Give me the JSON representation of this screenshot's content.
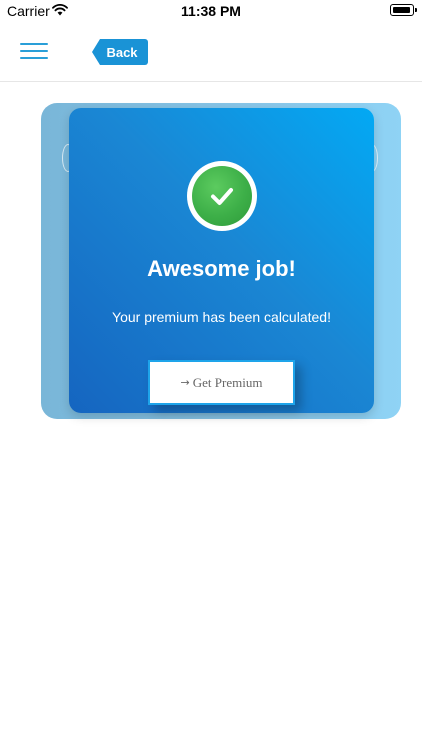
{
  "status_bar": {
    "carrier": "Carrier",
    "time": "11:38 PM",
    "wifi_icon": "wifi-icon",
    "battery_icon": "battery-icon"
  },
  "nav": {
    "menu_icon": "hamburger-menu-icon",
    "back_label": "Back"
  },
  "card": {
    "icon": "check-circle-icon",
    "title": "Awesome job!",
    "message": "Your premium has been calculated!",
    "button_arrow": "→",
    "button_label": "Get Premium"
  },
  "colors": {
    "accent": "#1a93d6",
    "card_gradient_start": "#03a9f4",
    "card_gradient_end": "#1565c0",
    "success_green": "#3daf48"
  }
}
